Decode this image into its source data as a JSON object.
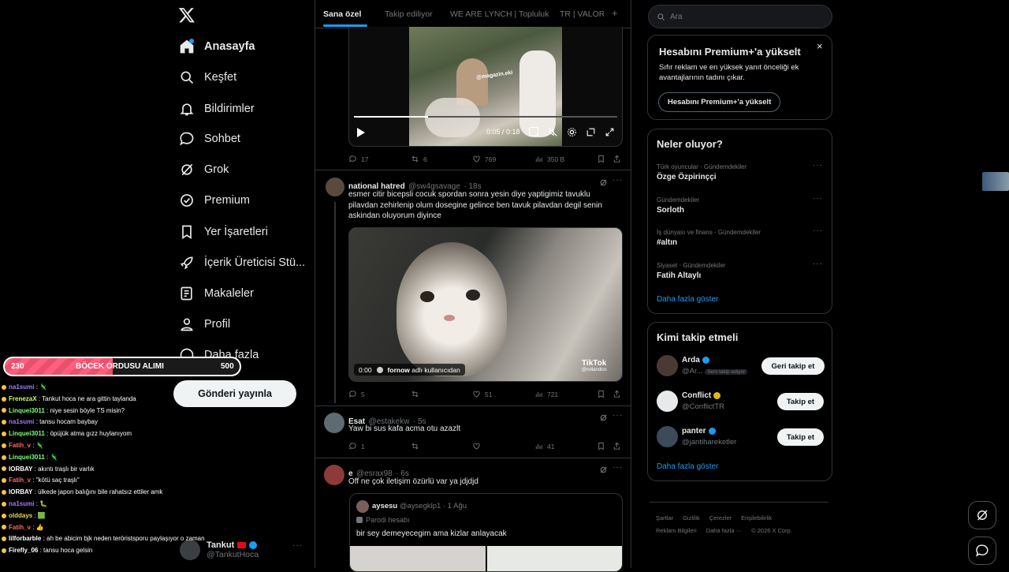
{
  "nav": {
    "items": [
      {
        "label": "Anasayfa",
        "icon": "home-icon",
        "bold": true
      },
      {
        "label": "Keşfet",
        "icon": "search-icon"
      },
      {
        "label": "Bildirimler",
        "icon": "bell-icon"
      },
      {
        "label": "Sohbet",
        "icon": "chat-bubble-icon"
      },
      {
        "label": "Grok",
        "icon": "grok-icon"
      },
      {
        "label": "Premium",
        "icon": "premium-badge-icon"
      },
      {
        "label": "Yer İşaretleri",
        "icon": "bookmark-icon"
      },
      {
        "label": "İçerik Üreticisi Stü...",
        "icon": "rocket-icon"
      },
      {
        "label": "Makaleler",
        "icon": "article-icon"
      },
      {
        "label": "Profil",
        "icon": "person-icon"
      },
      {
        "label": "Daha fazla",
        "icon": "more-circle-icon"
      }
    ],
    "post_button": "Gönderi yayınla",
    "account": {
      "name": "Tankut",
      "handle": "@TankutHoca"
    }
  },
  "overlay": {
    "goal": {
      "current": "230",
      "title": "BÖCEK ORDUSU ALIMI",
      "target": "500",
      "progress": 0.46
    },
    "chat": [
      {
        "user": "na1sumi",
        "msg": ": 🦎",
        "color": "#9d7cff"
      },
      {
        "user": "FrenezaX",
        "msg": ": Tankut hoca ne ara gittin taylanda",
        "color": "#c8ff5a"
      },
      {
        "user": "Linquei3011",
        "msg": ": niye sesin böyle TS misin?",
        "color": "#7cff7c"
      },
      {
        "user": "na1sumi",
        "msg": ": tansu hocam baybay",
        "color": "#9d7cff"
      },
      {
        "user": "Linquei3011",
        "msg": ": öpüjük atma gızz huylanıyom",
        "color": "#7cff7c"
      },
      {
        "user": "Fatih_v",
        "msg": ": 🦎",
        "color": "#ff6a6a"
      },
      {
        "user": "Linquei3011",
        "msg": ": 🦎",
        "color": "#7cff7c"
      },
      {
        "user": "IORBAY",
        "msg": ": akıntı traşlı bir varlık",
        "color": "#ffffff"
      },
      {
        "user": "Fatih_v",
        "msg": ": \"kötü saç traşlı\"",
        "color": "#ff6a6a"
      },
      {
        "user": "IORBAY",
        "msg": ": ülkede japon balığını bile rahatsız ettiler amk",
        "color": "#ffffff"
      },
      {
        "user": "na1sumi",
        "msg": ": 🐛",
        "color": "#9d7cff"
      },
      {
        "user": "olddays",
        "msg": ": 🟩",
        "color": "#e8d45a"
      },
      {
        "user": "Fatih_v",
        "msg": ": 👍",
        "color": "#ff6a6a"
      },
      {
        "user": "lilforbarble",
        "msg": ": ah be abicim bjk neden teröristsporu paylaşıyor o zaman",
        "color": "#ffffff"
      },
      {
        "user": "Firefly_06",
        "msg": ": tansu hoca gelsin",
        "color": "#ffffff"
      }
    ]
  },
  "tabs": [
    "Sana özel",
    "Takip ediliyor",
    "WE ARE LYNCH | Topluluk",
    "TR | VALORA",
    "+"
  ],
  "posts": [
    {
      "video": {
        "time": "0:05 / 0:18",
        "watermark": "@magazin.eki",
        "progress": 0.28
      },
      "stats": {
        "replies": "17",
        "reposts": "6",
        "likes": "769",
        "views": "350 B"
      }
    },
    {
      "name": "national hatred",
      "handle": "@sw4gsavage",
      "time": "· 18s",
      "text": "esmer citir bicepsli cocuk spordan sonra yesin diye yaptigimiz tavuklu pilavdan zehirlenip olum dosegine gelince ben tavuk pilavdan degil senin askindan oluyorum diyince",
      "video": {
        "time": "0:00",
        "attribution": "fornow",
        "attribution_suffix": "adlı kullanıcıdan",
        "tiktok": "TikTok",
        "tiktok_handle": "@rollandlos"
      },
      "stats": {
        "replies": "5",
        "reposts": "",
        "likes": "51",
        "views": "721"
      }
    },
    {
      "name": "Esat",
      "handle": "@estakekw",
      "time": "· 5s",
      "text": "Yaw bi sus kafa acma otu azazlt",
      "stats": {
        "replies": "1",
        "reposts": "",
        "likes": "",
        "views": "41"
      }
    },
    {
      "name": "e",
      "handle": "@esrax98",
      "time": "· 6s",
      "text": "Off ne çok iletişim özürlü var ya jdjdjd",
      "quote": {
        "name": "aysesu",
        "handle": "@aysegklp1",
        "time": "· 1 Ağu",
        "badge": "Parodi hesabı",
        "text": "bir sey demeyecegim ama kizlar anlayacak"
      }
    }
  ],
  "sidebar": {
    "search_placeholder": "Ara",
    "premium": {
      "title": "Hesabını Premium+'a yükselt",
      "text": "Sıfır reklam ve en yüksek yanıt önceliği ek avantajlarının tadını çıkar.",
      "button": "Hesabını Premium+'a yükselt"
    },
    "trends_title": "Neler oluyor?",
    "trends": [
      {
        "cat": "Türk oyuncular · Gündemdekiler",
        "name": "Özge Özpirinççi"
      },
      {
        "cat": "Gündemdekiler",
        "name": "Sorloth"
      },
      {
        "cat": "İş dünyası ve finans · Gündemdekiler",
        "name": "#altın"
      },
      {
        "cat": "Siyaset · Gündemdekiler",
        "name": "Fatih Altaylı"
      }
    ],
    "trends_more": "Daha fazla göster",
    "follow_title": "Kimi takip etmeli",
    "follow": [
      {
        "name": "Arda",
        "handle": "@Ar...",
        "tag": "Seni takip ediyor",
        "button": "Geri takip et",
        "verified": "blue"
      },
      {
        "name": "Conflict",
        "handle": "@ConflictTR",
        "button": "Takip et",
        "verified": "gold"
      },
      {
        "name": "panter",
        "handle": "@jantihareketler",
        "button": "Takip et",
        "verified": "blue"
      }
    ],
    "follow_more": "Daha fazla göster",
    "footer": [
      "Şartlar",
      "Gizlilik",
      "Çerezler",
      "Erişilebilirlik",
      "Reklam Bilgileri",
      "Daha fazla ···",
      "© 2026 X Corp."
    ]
  }
}
